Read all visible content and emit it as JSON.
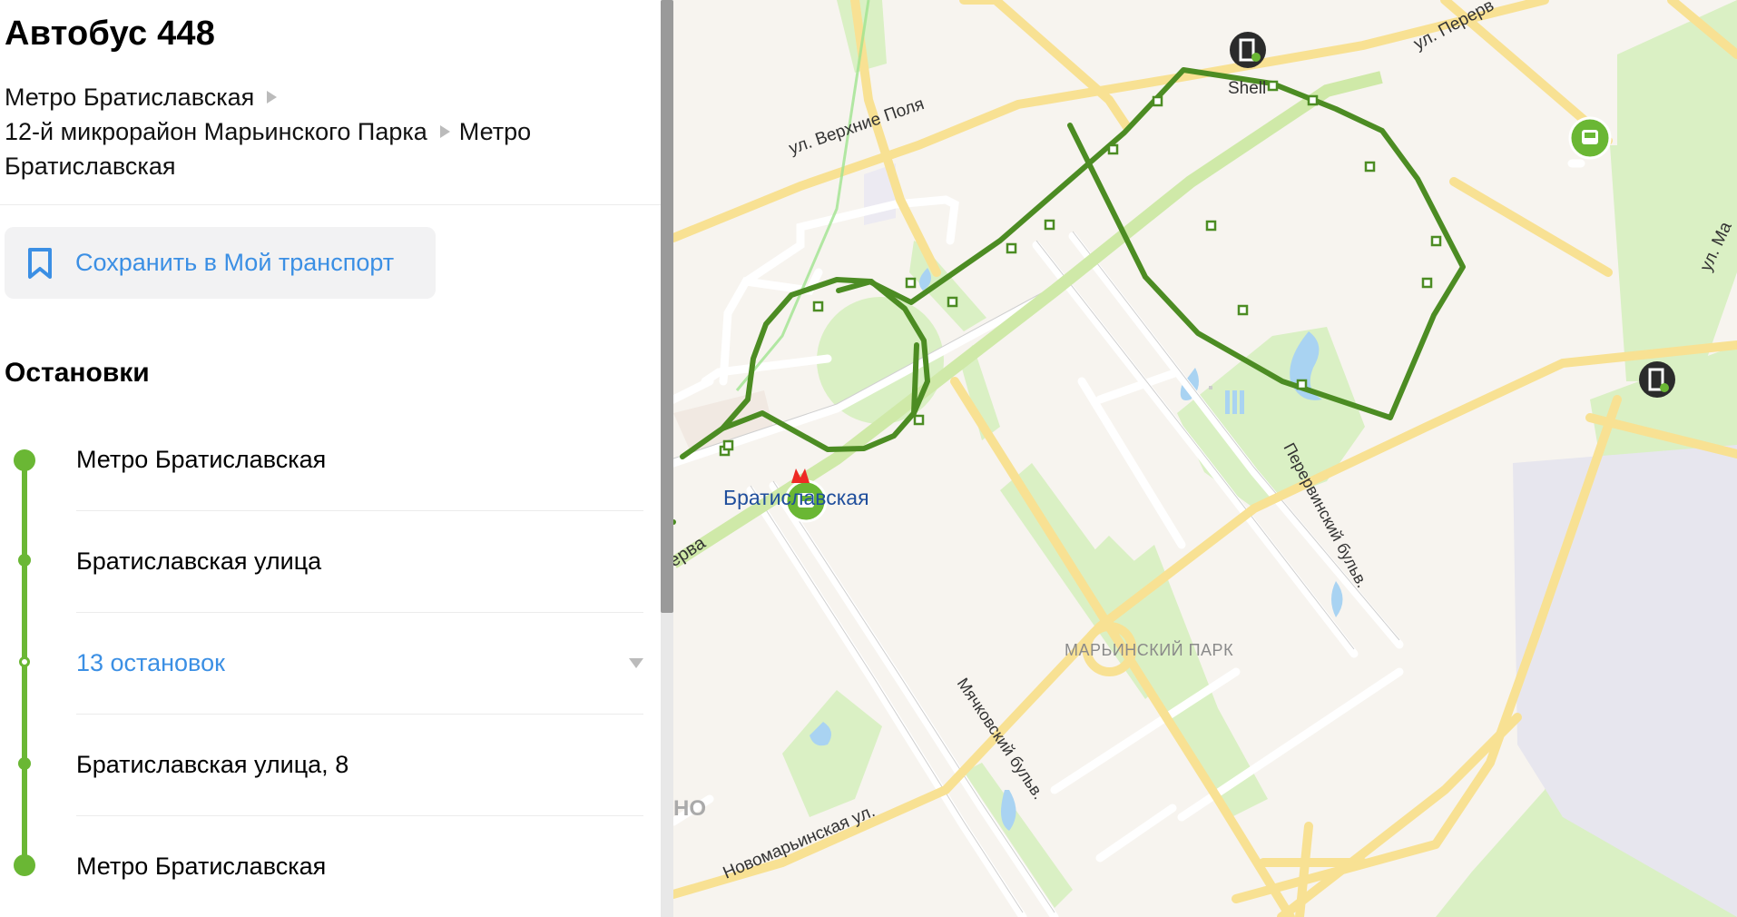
{
  "panel": {
    "title": "Автобус 448",
    "route": {
      "from": "Метро Братиславская",
      "via": "12-й микрорайон Марьинского Парка",
      "to": "Метро Братиславская"
    },
    "save_button": {
      "label": "Сохранить в Мой транспорт",
      "icon": "bookmark-icon"
    },
    "stops_heading": "Остановки",
    "stops": [
      {
        "name": "Метро Братиславская"
      },
      {
        "name": "Братиславская улица"
      },
      {
        "name": "13 остановок",
        "collapsed": true
      },
      {
        "name": "Братиславская улица, 8"
      },
      {
        "name": "Метро Братиславская"
      }
    ]
  },
  "map": {
    "labels": {
      "verkhnie_polya": "ул. Верхние Поля",
      "perervinskaya_top": "ул. Перерв",
      "mariinskaya": "ул. Ма",
      "shell": "Shell",
      "metro_station": "Братиславская",
      "lyublino_part": "ерва",
      "district": "МАРЬИНСКИЙ ПАРК",
      "myachkovsky": "Мячковский бульв.",
      "perervinsky": "Перервинский бульв.",
      "novomarinskaya": "Новомарьинская ул.",
      "no_fragment": "НО"
    },
    "colors": {
      "route": "#4c8c23",
      "road_major": "#f8e193",
      "road_minor": "#ffffff",
      "park": "#daf0c4",
      "water": "#a9d3f2",
      "stop_marker": "#6ab734",
      "metro": "#ee2a24"
    }
  }
}
